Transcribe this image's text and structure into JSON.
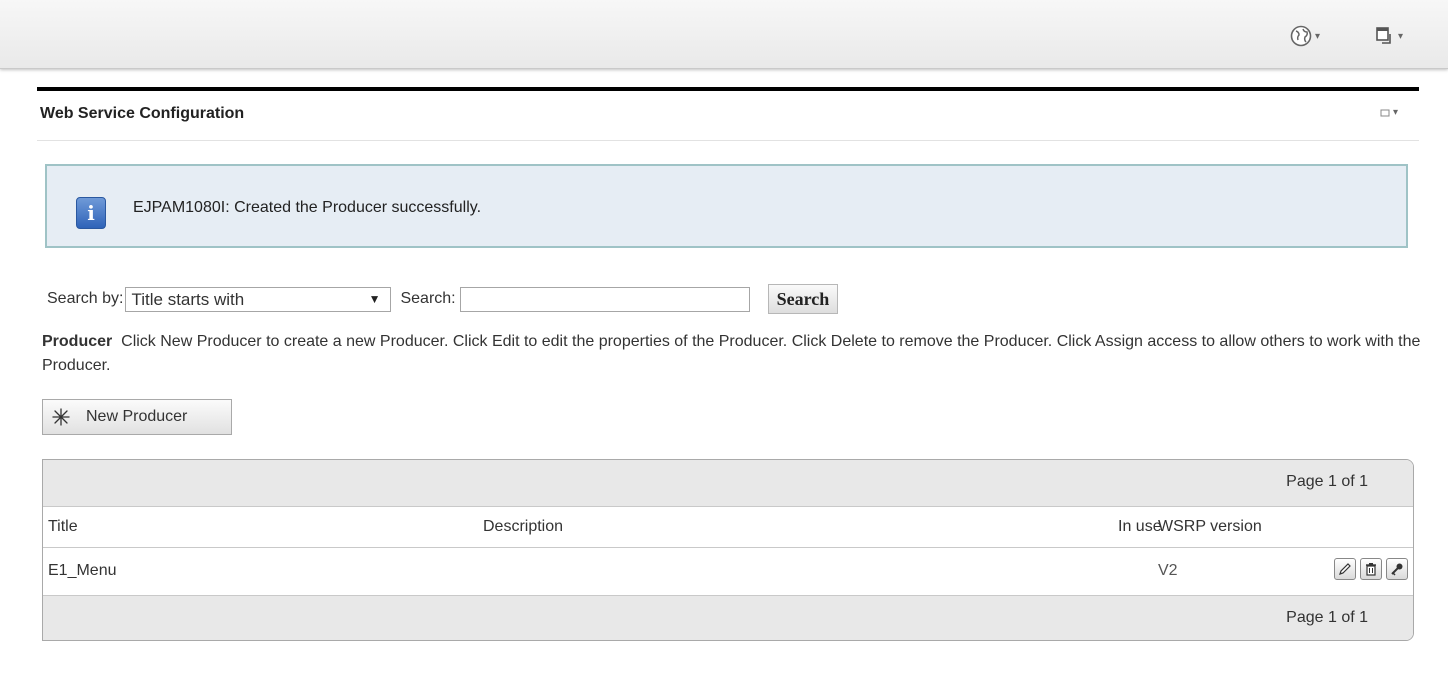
{
  "toolbar": {
    "globe_icon": "globe-icon",
    "window_icon": "window-icon"
  },
  "portlet": {
    "title": "Web Service Configuration"
  },
  "message": {
    "text": "EJPAM1080I: Created the Producer successfully.",
    "icon": "info-icon",
    "icon_glyph": "i"
  },
  "search": {
    "by_label": "Search by:",
    "by_value": "Title starts with",
    "search_label": "Search:",
    "input_value": "",
    "button_label": "Search"
  },
  "help": {
    "bold": "Producer",
    "text": "Click New Producer to create a new Producer. Click Edit to edit the properties of the Producer. Click Delete to remove the Producer. Click Assign access to allow others to work with the Producer."
  },
  "new_button": {
    "label": "New Producer",
    "icon": "star-icon"
  },
  "table": {
    "page_info_top": "Page 1 of 1",
    "page_info_bottom": "Page 1 of 1",
    "columns": {
      "title": "Title",
      "description": "Description",
      "in_use": "In use",
      "wsrp_version": "WSRP version"
    },
    "rows": [
      {
        "title": "E1_Menu",
        "description": "",
        "in_use": "",
        "wsrp_version": "V2",
        "actions": [
          "edit-icon",
          "delete-icon",
          "assign-access-icon"
        ]
      }
    ]
  },
  "colors": {
    "message_bg": "#e6edf4",
    "message_border": "#9fc3c6",
    "info_icon": "#2f63b8"
  }
}
